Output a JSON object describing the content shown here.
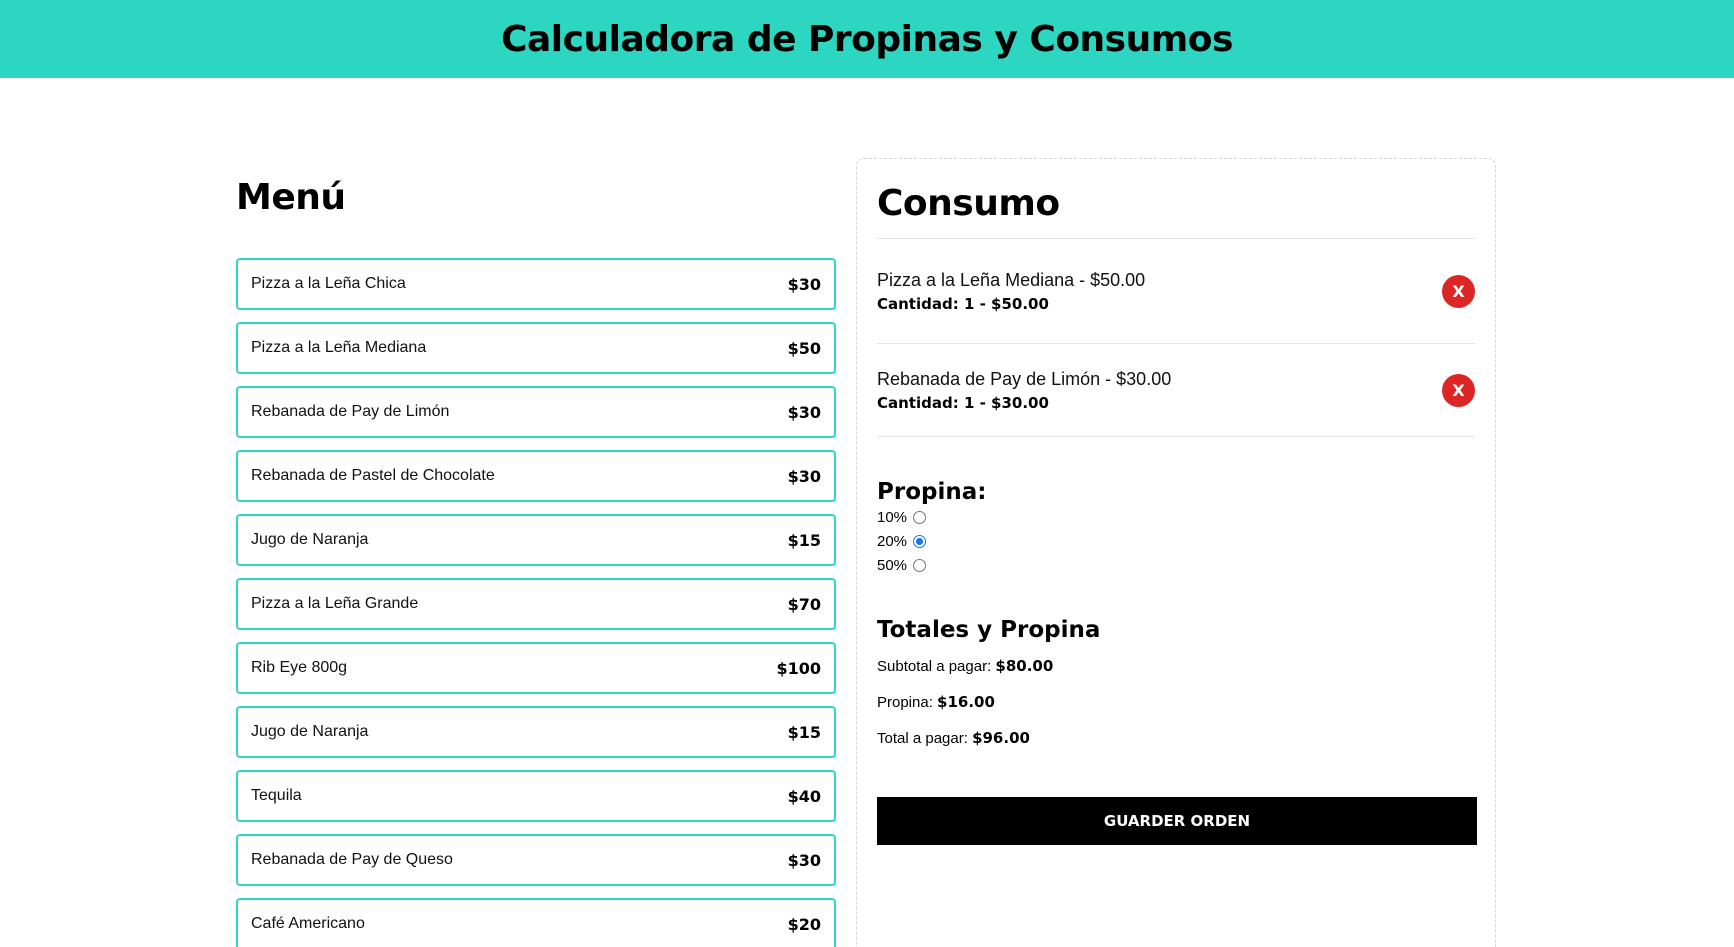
{
  "header": {
    "title": "Calculadora de Propinas y Consumos"
  },
  "menu": {
    "title": "Menú",
    "items": [
      {
        "name": "Pizza a la Leña Chica",
        "price": "$30"
      },
      {
        "name": "Pizza a la Leña Mediana",
        "price": "$50"
      },
      {
        "name": "Rebanada de Pay de Limón",
        "price": "$30"
      },
      {
        "name": "Rebanada de Pastel de Chocolate",
        "price": "$30"
      },
      {
        "name": "Jugo de Naranja",
        "price": "$15"
      },
      {
        "name": "Pizza a la Leña Grande",
        "price": "$70"
      },
      {
        "name": "Rib Eye 800g",
        "price": "$100"
      },
      {
        "name": "Jugo de Naranja",
        "price": "$15"
      },
      {
        "name": "Tequila",
        "price": "$40"
      },
      {
        "name": "Rebanada de Pay de Queso",
        "price": "$30"
      },
      {
        "name": "Café Americano",
        "price": "$20"
      }
    ]
  },
  "consumo": {
    "title": "Consumo",
    "items": [
      {
        "line1": "Pizza a la Leña Mediana - $50.00",
        "line2": "Cantidad: 1 - $50.00",
        "remove_label": "X"
      },
      {
        "line1": "Rebanada de Pay de Limón - $30.00",
        "line2": "Cantidad: 1 - $30.00",
        "remove_label": "X"
      }
    ],
    "tip": {
      "title": "Propina:",
      "options": [
        {
          "label": "10%",
          "checked": false
        },
        {
          "label": "20%",
          "checked": true
        },
        {
          "label": "50%",
          "checked": false
        }
      ]
    },
    "totals": {
      "title": "Totales y Propina",
      "subtotal_label": "Subtotal a pagar: ",
      "subtotal_value": "$80.00",
      "tip_label": "Propina: ",
      "tip_value": "$16.00",
      "total_label": "Total a pagar: ",
      "total_value": "$96.00"
    },
    "save_label": "Guarder Orden"
  },
  "colors": {
    "accent": "#2dd6c1",
    "remove": "#dc2626",
    "button": "#000000"
  }
}
